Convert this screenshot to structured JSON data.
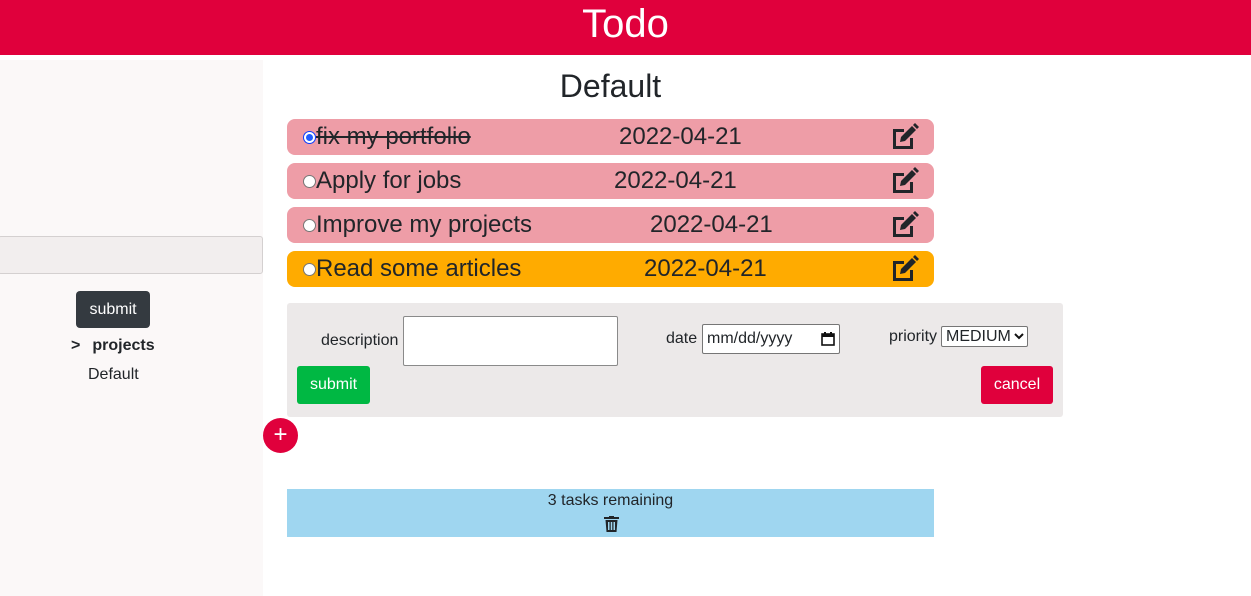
{
  "header": {
    "title": "Todo"
  },
  "sidebar": {
    "submit_label": "submit",
    "projects_arrow": ">",
    "projects_label": "projects",
    "project_items": [
      "Default"
    ]
  },
  "project": {
    "heading": "Default"
  },
  "tasks": [
    {
      "title": "fix my portfolio",
      "date": "2022-04-21",
      "completed": true,
      "priority": "low"
    },
    {
      "title": "Apply for jobs",
      "date": "2022-04-21",
      "completed": false,
      "priority": "low"
    },
    {
      "title": "Improve my projects",
      "date": "2022-04-21",
      "completed": false,
      "priority": "low"
    },
    {
      "title": "Read some articles",
      "date": "2022-04-21",
      "completed": false,
      "priority": "high"
    }
  ],
  "form": {
    "description_label": "description",
    "description_value": "",
    "date_label": "date",
    "date_placeholder": "mm/dd/yyyy",
    "priority_label": "priority",
    "priority_selected": "MEDIUM",
    "submit_label": "submit",
    "cancel_label": "cancel"
  },
  "add_button_label": "+",
  "footer": {
    "remaining_text": "3 tasks remaining"
  },
  "colors": {
    "brand": "#e0003c",
    "task_default": "#ee9da7",
    "task_high": "#ffab00",
    "submit_green": "#00b843",
    "footer": "#9fd6f0",
    "dark_button": "#343a40"
  },
  "icons": {
    "edit": "edit-icon",
    "trash": "trash-icon",
    "calendar": "calendar-icon",
    "add": "plus-icon"
  }
}
